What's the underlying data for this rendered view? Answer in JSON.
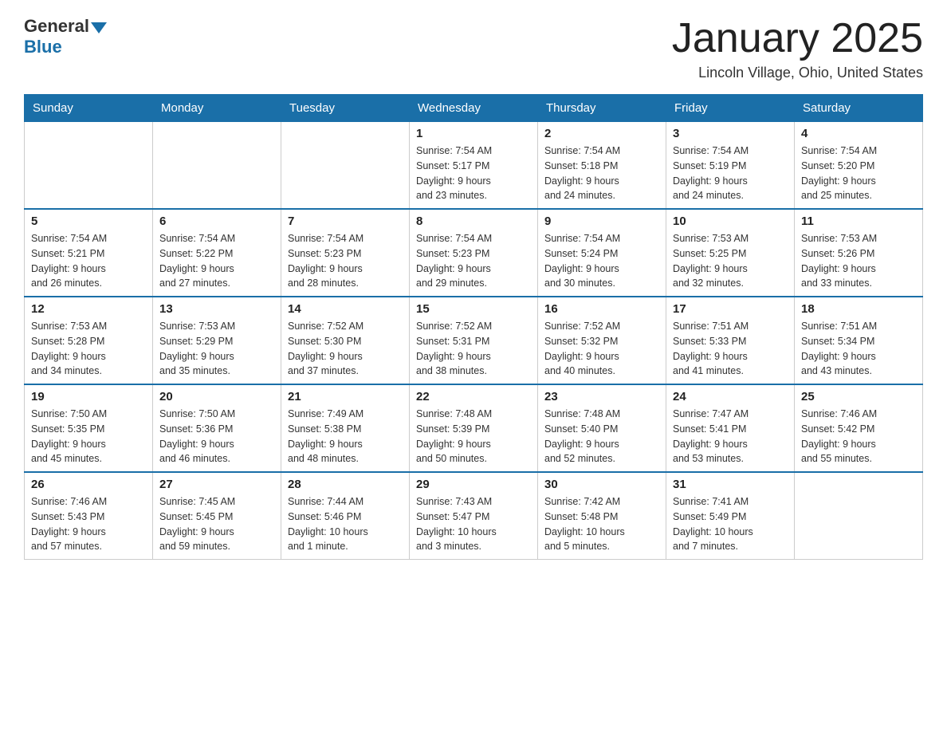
{
  "header": {
    "logo": {
      "general": "General",
      "blue": "Blue",
      "tagline": "GeneralBlue"
    },
    "title": "January 2025",
    "location": "Lincoln Village, Ohio, United States"
  },
  "days_of_week": [
    "Sunday",
    "Monday",
    "Tuesday",
    "Wednesday",
    "Thursday",
    "Friday",
    "Saturday"
  ],
  "weeks": [
    [
      {
        "day": "",
        "info": ""
      },
      {
        "day": "",
        "info": ""
      },
      {
        "day": "",
        "info": ""
      },
      {
        "day": "1",
        "info": "Sunrise: 7:54 AM\nSunset: 5:17 PM\nDaylight: 9 hours\nand 23 minutes."
      },
      {
        "day": "2",
        "info": "Sunrise: 7:54 AM\nSunset: 5:18 PM\nDaylight: 9 hours\nand 24 minutes."
      },
      {
        "day": "3",
        "info": "Sunrise: 7:54 AM\nSunset: 5:19 PM\nDaylight: 9 hours\nand 24 minutes."
      },
      {
        "day": "4",
        "info": "Sunrise: 7:54 AM\nSunset: 5:20 PM\nDaylight: 9 hours\nand 25 minutes."
      }
    ],
    [
      {
        "day": "5",
        "info": "Sunrise: 7:54 AM\nSunset: 5:21 PM\nDaylight: 9 hours\nand 26 minutes."
      },
      {
        "day": "6",
        "info": "Sunrise: 7:54 AM\nSunset: 5:22 PM\nDaylight: 9 hours\nand 27 minutes."
      },
      {
        "day": "7",
        "info": "Sunrise: 7:54 AM\nSunset: 5:23 PM\nDaylight: 9 hours\nand 28 minutes."
      },
      {
        "day": "8",
        "info": "Sunrise: 7:54 AM\nSunset: 5:23 PM\nDaylight: 9 hours\nand 29 minutes."
      },
      {
        "day": "9",
        "info": "Sunrise: 7:54 AM\nSunset: 5:24 PM\nDaylight: 9 hours\nand 30 minutes."
      },
      {
        "day": "10",
        "info": "Sunrise: 7:53 AM\nSunset: 5:25 PM\nDaylight: 9 hours\nand 32 minutes."
      },
      {
        "day": "11",
        "info": "Sunrise: 7:53 AM\nSunset: 5:26 PM\nDaylight: 9 hours\nand 33 minutes."
      }
    ],
    [
      {
        "day": "12",
        "info": "Sunrise: 7:53 AM\nSunset: 5:28 PM\nDaylight: 9 hours\nand 34 minutes."
      },
      {
        "day": "13",
        "info": "Sunrise: 7:53 AM\nSunset: 5:29 PM\nDaylight: 9 hours\nand 35 minutes."
      },
      {
        "day": "14",
        "info": "Sunrise: 7:52 AM\nSunset: 5:30 PM\nDaylight: 9 hours\nand 37 minutes."
      },
      {
        "day": "15",
        "info": "Sunrise: 7:52 AM\nSunset: 5:31 PM\nDaylight: 9 hours\nand 38 minutes."
      },
      {
        "day": "16",
        "info": "Sunrise: 7:52 AM\nSunset: 5:32 PM\nDaylight: 9 hours\nand 40 minutes."
      },
      {
        "day": "17",
        "info": "Sunrise: 7:51 AM\nSunset: 5:33 PM\nDaylight: 9 hours\nand 41 minutes."
      },
      {
        "day": "18",
        "info": "Sunrise: 7:51 AM\nSunset: 5:34 PM\nDaylight: 9 hours\nand 43 minutes."
      }
    ],
    [
      {
        "day": "19",
        "info": "Sunrise: 7:50 AM\nSunset: 5:35 PM\nDaylight: 9 hours\nand 45 minutes."
      },
      {
        "day": "20",
        "info": "Sunrise: 7:50 AM\nSunset: 5:36 PM\nDaylight: 9 hours\nand 46 minutes."
      },
      {
        "day": "21",
        "info": "Sunrise: 7:49 AM\nSunset: 5:38 PM\nDaylight: 9 hours\nand 48 minutes."
      },
      {
        "day": "22",
        "info": "Sunrise: 7:48 AM\nSunset: 5:39 PM\nDaylight: 9 hours\nand 50 minutes."
      },
      {
        "day": "23",
        "info": "Sunrise: 7:48 AM\nSunset: 5:40 PM\nDaylight: 9 hours\nand 52 minutes."
      },
      {
        "day": "24",
        "info": "Sunrise: 7:47 AM\nSunset: 5:41 PM\nDaylight: 9 hours\nand 53 minutes."
      },
      {
        "day": "25",
        "info": "Sunrise: 7:46 AM\nSunset: 5:42 PM\nDaylight: 9 hours\nand 55 minutes."
      }
    ],
    [
      {
        "day": "26",
        "info": "Sunrise: 7:46 AM\nSunset: 5:43 PM\nDaylight: 9 hours\nand 57 minutes."
      },
      {
        "day": "27",
        "info": "Sunrise: 7:45 AM\nSunset: 5:45 PM\nDaylight: 9 hours\nand 59 minutes."
      },
      {
        "day": "28",
        "info": "Sunrise: 7:44 AM\nSunset: 5:46 PM\nDaylight: 10 hours\nand 1 minute."
      },
      {
        "day": "29",
        "info": "Sunrise: 7:43 AM\nSunset: 5:47 PM\nDaylight: 10 hours\nand 3 minutes."
      },
      {
        "day": "30",
        "info": "Sunrise: 7:42 AM\nSunset: 5:48 PM\nDaylight: 10 hours\nand 5 minutes."
      },
      {
        "day": "31",
        "info": "Sunrise: 7:41 AM\nSunset: 5:49 PM\nDaylight: 10 hours\nand 7 minutes."
      },
      {
        "day": "",
        "info": ""
      }
    ]
  ]
}
